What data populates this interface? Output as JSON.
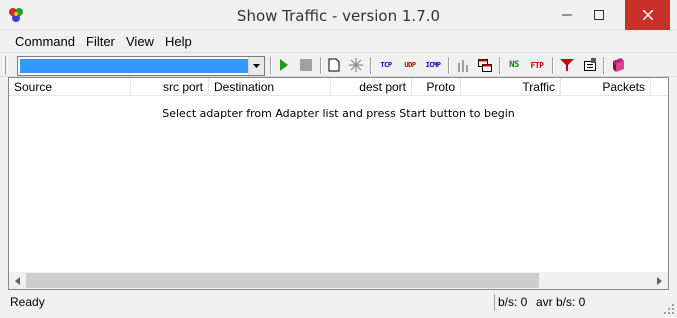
{
  "window": {
    "title": "Show Traffic - version 1.7.0",
    "icon": "app-multicolor-icon"
  },
  "window_controls": {
    "minimize": "minimize-icon",
    "maximize": "maximize-icon",
    "close": "close-icon"
  },
  "menu": {
    "items": [
      "Command",
      "Filter",
      "View",
      "Help"
    ]
  },
  "toolbar": {
    "adapter_value": "",
    "buttons": [
      {
        "name": "start",
        "icon": "play-icon",
        "color": "#1a9c1a"
      },
      {
        "name": "stop",
        "icon": "stop-icon",
        "color": "#a0a0a0"
      },
      {
        "name": "new",
        "icon": "new-document-icon"
      },
      {
        "name": "clear",
        "icon": "asterisk-icon"
      },
      {
        "name": "tcp",
        "label": "TCP",
        "color": "#0000c8"
      },
      {
        "name": "udp",
        "label": "UDP",
        "color": "#c80000"
      },
      {
        "name": "icmp",
        "label": "ICMP",
        "color": "#0000c8"
      },
      {
        "name": "stats",
        "icon": "bar-chart-icon"
      },
      {
        "name": "windows",
        "icon": "windows-icon"
      },
      {
        "name": "dns",
        "label": "NS",
        "color": "#0a8a0a"
      },
      {
        "name": "ftp",
        "label": "FTP",
        "color": "#c80000"
      },
      {
        "name": "filter",
        "icon": "filter-icon"
      },
      {
        "name": "options",
        "icon": "options-icon"
      },
      {
        "name": "about",
        "icon": "book-icon"
      }
    ]
  },
  "columns": [
    {
      "label": "Source",
      "align": "left"
    },
    {
      "label": "src port",
      "align": "right"
    },
    {
      "label": "Destination",
      "align": "left"
    },
    {
      "label": "dest port",
      "align": "right"
    },
    {
      "label": "Proto",
      "align": "right"
    },
    {
      "label": "Traffic",
      "align": "right"
    },
    {
      "label": "Packets",
      "align": "right"
    }
  ],
  "list": {
    "empty_message": "Select adapter from Adapter list and press Start button to begin"
  },
  "status": {
    "text": "Ready",
    "bps": "b/s: 0",
    "avr_bps": "avr b/s: 0"
  },
  "colors": {
    "close_button": "#c7312a",
    "selection": "#3399ff"
  }
}
